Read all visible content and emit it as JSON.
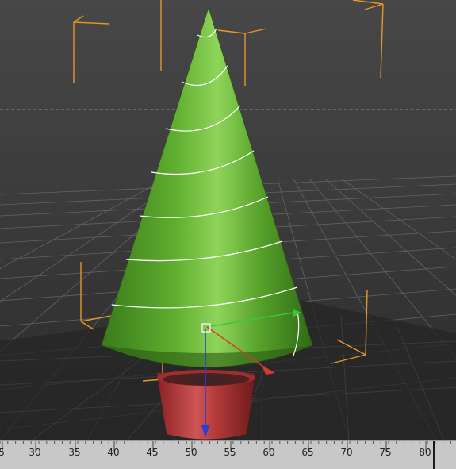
{
  "colors": {
    "background_top": "#454545",
    "background_bottom": "#2b2b2b",
    "grid_line": "#6a6a6a",
    "grid_dark": "#1f1f1f",
    "cone_light": "#8ed14d",
    "cone_mid": "#4f9e27",
    "cone_dark": "#2c5f14",
    "pot_light": "#d25555",
    "pot_dark": "#7a1e1e",
    "spiral": "#ffffff",
    "locator": "#e89a2b",
    "axis_x": "#d63b2b",
    "axis_y": "#3fc43f",
    "axis_z": "#2a3fd8",
    "timeline_bg": "#c8c8c8"
  },
  "timeline": {
    "frame_labels": [
      "5",
      "30",
      "35",
      "40",
      "45",
      "50",
      "55",
      "60",
      "65",
      "70",
      "75",
      "80"
    ]
  },
  "icons": [
    "move-manipulator-icon"
  ]
}
